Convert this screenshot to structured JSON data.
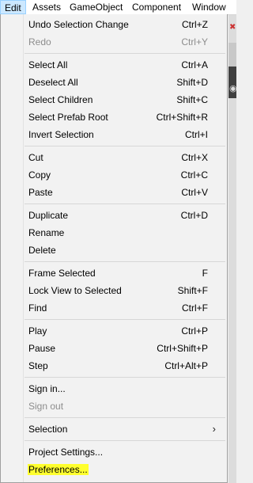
{
  "menubar": {
    "items": [
      {
        "label": "Edit"
      },
      {
        "label": "Assets"
      },
      {
        "label": "GameObject"
      },
      {
        "label": "Component"
      },
      {
        "label": "Window"
      }
    ]
  },
  "edit_menu": {
    "items": [
      {
        "label": "Undo Selection Change",
        "shortcut": "Ctrl+Z"
      },
      {
        "label": "Redo",
        "shortcut": "Ctrl+Y"
      },
      {
        "label": "Select All",
        "shortcut": "Ctrl+A"
      },
      {
        "label": "Deselect All",
        "shortcut": "Shift+D"
      },
      {
        "label": "Select Children",
        "shortcut": "Shift+C"
      },
      {
        "label": "Select Prefab Root",
        "shortcut": "Ctrl+Shift+R"
      },
      {
        "label": "Invert Selection",
        "shortcut": "Ctrl+I"
      },
      {
        "label": "Cut",
        "shortcut": "Ctrl+X"
      },
      {
        "label": "Copy",
        "shortcut": "Ctrl+C"
      },
      {
        "label": "Paste",
        "shortcut": "Ctrl+V"
      },
      {
        "label": "Duplicate",
        "shortcut": "Ctrl+D"
      },
      {
        "label": "Rename",
        "shortcut": ""
      },
      {
        "label": "Delete",
        "shortcut": ""
      },
      {
        "label": "Frame Selected",
        "shortcut": "F"
      },
      {
        "label": "Lock View to Selected",
        "shortcut": "Shift+F"
      },
      {
        "label": "Find",
        "shortcut": "Ctrl+F"
      },
      {
        "label": "Play",
        "shortcut": "Ctrl+P"
      },
      {
        "label": "Pause",
        "shortcut": "Ctrl+Shift+P"
      },
      {
        "label": "Step",
        "shortcut": "Ctrl+Alt+P"
      },
      {
        "label": "Sign in...",
        "shortcut": ""
      },
      {
        "label": "Sign out",
        "shortcut": ""
      },
      {
        "label": "Selection",
        "shortcut": ""
      },
      {
        "label": "Project Settings...",
        "shortcut": ""
      },
      {
        "label": "Preferences...",
        "shortcut": ""
      }
    ]
  },
  "colors": {
    "highlight": "#ffff2e",
    "disabled_text": "#8d8d8d",
    "menubar_active": "#cce8ff"
  }
}
